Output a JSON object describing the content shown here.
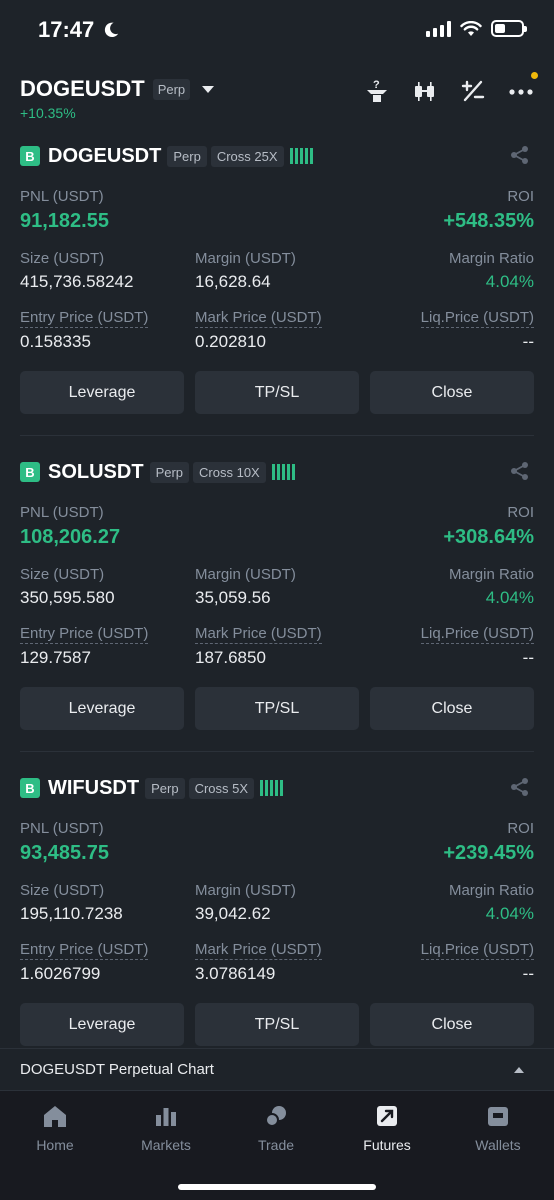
{
  "status": {
    "time": "17:47"
  },
  "header": {
    "symbol": "DOGEUSDT",
    "tag": "Perp",
    "change": "+10.35%"
  },
  "labels": {
    "pnl": "PNL (USDT)",
    "roi": "ROI",
    "size": "Size (USDT)",
    "margin": "Margin (USDT)",
    "margin_ratio": "Margin Ratio",
    "entry": "Entry Price (USDT)",
    "mark": "Mark Price (USDT)",
    "liq": "Liq.Price (USDT)"
  },
  "buttons": {
    "leverage": "Leverage",
    "tpsl": "TP/SL",
    "close": "Close"
  },
  "positions": [
    {
      "side": "B",
      "symbol": "DOGEUSDT",
      "type": "Perp",
      "mode": "Cross 25X",
      "pnl": "91,182.55",
      "roi": "+548.35%",
      "size": "415,736.58242",
      "margin": "16,628.64",
      "margin_ratio": "4.04%",
      "entry": "0.158335",
      "mark": "0.202810",
      "liq": "--"
    },
    {
      "side": "B",
      "symbol": "SOLUSDT",
      "type": "Perp",
      "mode": "Cross 10X",
      "pnl": "108,206.27",
      "roi": "+308.64%",
      "size": "350,595.580",
      "margin": "35,059.56",
      "margin_ratio": "4.04%",
      "entry": "129.7587",
      "mark": "187.6850",
      "liq": "--"
    },
    {
      "side": "B",
      "symbol": "WIFUSDT",
      "type": "Perp",
      "mode": "Cross 5X",
      "pnl": "93,485.75",
      "roi": "+239.45%",
      "size": "195,110.7238",
      "margin": "39,042.62",
      "margin_ratio": "4.04%",
      "entry": "1.6026799",
      "mark": "3.0786149",
      "liq": "--"
    }
  ],
  "chart_bar": {
    "label": "DOGEUSDT Perpetual  Chart"
  },
  "tabs": [
    {
      "label": "Home",
      "icon": "home-icon"
    },
    {
      "label": "Markets",
      "icon": "markets-icon"
    },
    {
      "label": "Trade",
      "icon": "trade-icon"
    },
    {
      "label": "Futures",
      "icon": "futures-icon",
      "active": true
    },
    {
      "label": "Wallets",
      "icon": "wallet-icon"
    }
  ],
  "colors": {
    "up": "#2ebd85",
    "bg": "#1e2329",
    "panel": "#2b3139",
    "accent": "#f0b90b"
  }
}
